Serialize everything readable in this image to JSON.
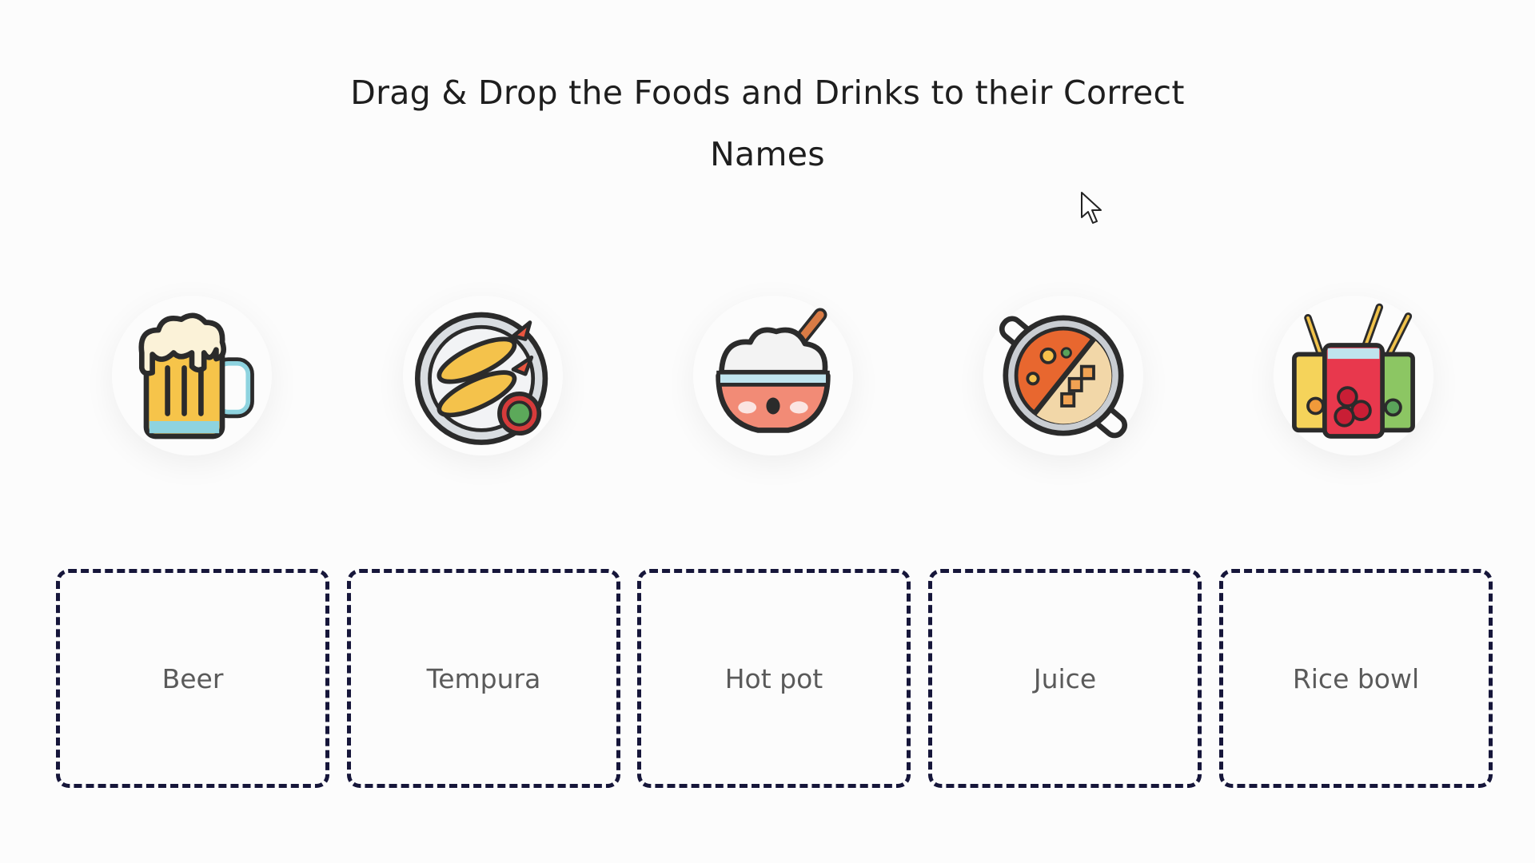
{
  "header": {
    "title": "Drag & Drop the Foods and Drinks to their Correct Names"
  },
  "draggables": [
    {
      "icon": "beer-mug-icon"
    },
    {
      "icon": "tempura-plate-icon"
    },
    {
      "icon": "rice-bowl-icon"
    },
    {
      "icon": "hot-pot-icon"
    },
    {
      "icon": "juice-glasses-icon"
    }
  ],
  "drop_zones": [
    {
      "label": "Beer"
    },
    {
      "label": "Tempura"
    },
    {
      "label": "Hot pot"
    },
    {
      "label": "Juice"
    },
    {
      "label": "Rice bowl"
    }
  ],
  "colors": {
    "drop_border": "#16163a",
    "label_text": "#5a5a5a",
    "background": "#fcfcfc"
  }
}
